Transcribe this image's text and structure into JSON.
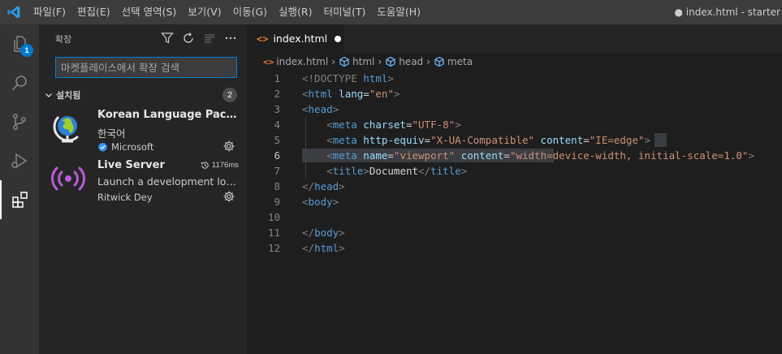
{
  "titlebar": {
    "menu": [
      "파일(F)",
      "편집(E)",
      "선택 영역(S)",
      "보기(V)",
      "이동(G)",
      "실행(R)",
      "터미널(T)",
      "도움말(H)"
    ],
    "window_title": "● index.html - starter"
  },
  "activity": {
    "explorer_badge": "1"
  },
  "sidebar": {
    "title": "확장",
    "search_placeholder": "마켓플레이스에서 확장 검색",
    "section_label": "설치됨",
    "section_count": "2",
    "extensions": [
      {
        "name": "Korean Language Pack for...",
        "desc": "한국어",
        "publisher": "Microsoft",
        "icon": "globe-icon"
      },
      {
        "name": "Live Server",
        "desc": "Launch a development local...",
        "publisher": "Ritwick Dey",
        "time": "1176ms",
        "icon": "broadcast-icon"
      }
    ]
  },
  "editor": {
    "tab_label": "index.html",
    "breadcrumb": [
      "index.html",
      "html",
      "head",
      "meta"
    ],
    "line_numbers": [
      "1",
      "2",
      "3",
      "4",
      "5",
      "6",
      "7",
      "8",
      "9",
      "10",
      "11",
      "12"
    ],
    "code": {
      "l1": {
        "a": "<!DOCTYPE ",
        "b": "html",
        "c": ">"
      },
      "l2": {
        "a": "<",
        "b": "html",
        "c": " ",
        "d": "lang",
        "e": "=",
        "f": "\"en\"",
        "g": ">"
      },
      "l3": {
        "a": "<",
        "b": "head",
        "c": ">"
      },
      "l4": {
        "a": "    <",
        "b": "meta",
        "c": " ",
        "d": "charset",
        "e": "=",
        "f": "\"UTF-8\"",
        "g": ">"
      },
      "l5": {
        "a": "    <",
        "b": "meta",
        "c": " ",
        "d": "http-equiv",
        "e": "=",
        "f": "\"X-UA-Compatible\"",
        "g": " ",
        "h": "content",
        "i": "=",
        "j": "\"IE=edge\"",
        "k": ">"
      },
      "l6": {
        "a": "    <",
        "b": "meta",
        "c": " ",
        "d": "name",
        "e": "=",
        "f": "\"viewport\"",
        "g": " ",
        "h": "content",
        "i": "=",
        "j": "\"width=device-width, initial-scale=1.0\"",
        "k": ">"
      },
      "l7": {
        "a": "    <",
        "b": "title",
        "c": ">",
        "d": "Document",
        "e": "</",
        "f": "title",
        "g": ">"
      },
      "l8": {
        "a": "</",
        "b": "head",
        "c": ">"
      },
      "l9": {
        "a": "<",
        "b": "body",
        "c": ">"
      },
      "l11": {
        "a": "</",
        "b": "body",
        "c": ">"
      },
      "l12": {
        "a": "</",
        "b": "html",
        "c": ">"
      }
    }
  },
  "colors": {
    "accent": "#007acc",
    "focus_border": "#007fd4",
    "tag": "#569cd6",
    "attr": "#9cdcfe",
    "string": "#ce9178",
    "html_icon": "#e37933"
  }
}
